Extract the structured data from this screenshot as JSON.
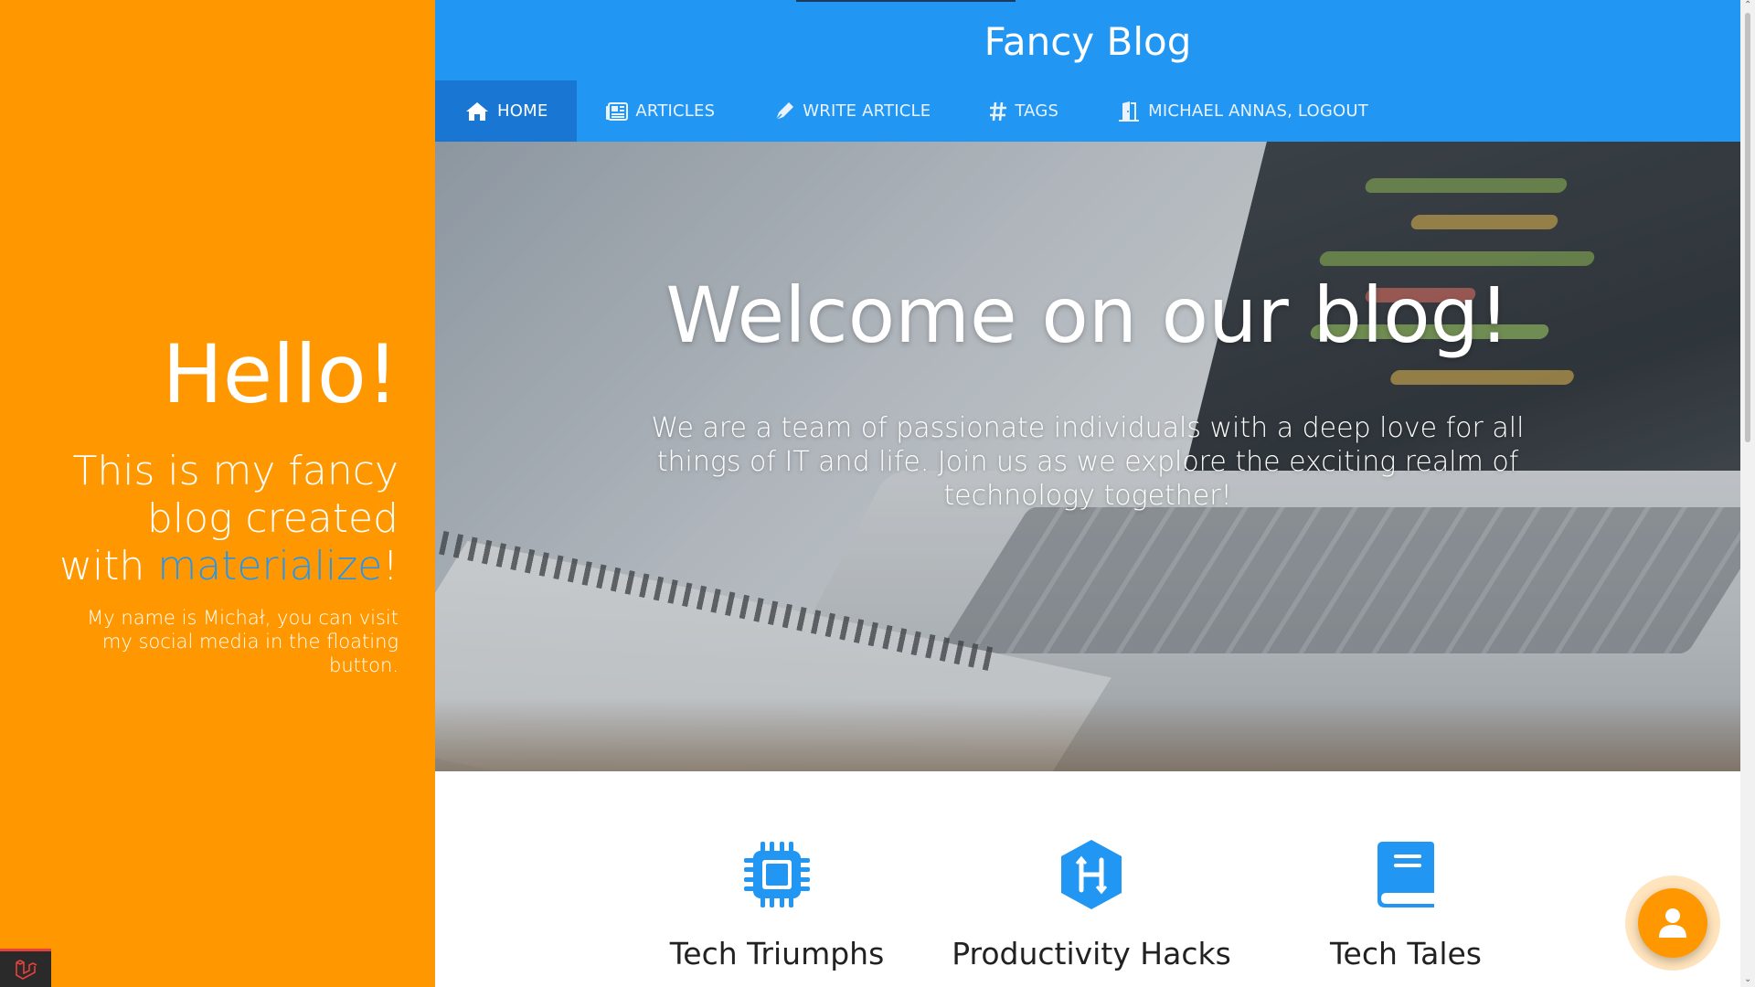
{
  "sidebar": {
    "hello": "Hello!",
    "tagline_prefix": "This is my fancy blog created with ",
    "tagline_accent": "materialize",
    "tagline_suffix": "!",
    "intro": "My name is Michał, you can visit my social media in the floating button."
  },
  "header": {
    "brand": "Fancy Blog",
    "nav": [
      {
        "label": "HOME",
        "icon": "home-icon",
        "active": true
      },
      {
        "label": "ARTICLES",
        "icon": "newspaper-icon"
      },
      {
        "label": "WRITE ARTICLE",
        "icon": "pen-icon"
      },
      {
        "label": "TAGS",
        "icon": "hashtag-icon"
      },
      {
        "label": "MICHAEL ANNAS, LOGOUT",
        "icon": "door-open-icon"
      }
    ]
  },
  "hero": {
    "title": "Welcome on our blog!",
    "text": "We are a team of passionate individuals with a deep love for all things of IT and life. Join us as we explore the exciting realm of technology together!"
  },
  "features": [
    {
      "label": "Tech Triumphs",
      "icon": "microchip-icon"
    },
    {
      "label": "Productivity Hacks",
      "icon": "hackerrank-icon"
    },
    {
      "label": "Tech Tales",
      "icon": "book-icon"
    }
  ],
  "fab": {
    "icon": "user-icon"
  },
  "colors": {
    "sidebar_bg": "#ff9800",
    "header_bg": "#2196f3",
    "nav_active": "#1976d2",
    "accent": "#2196f3",
    "fab": "#ff9800"
  }
}
